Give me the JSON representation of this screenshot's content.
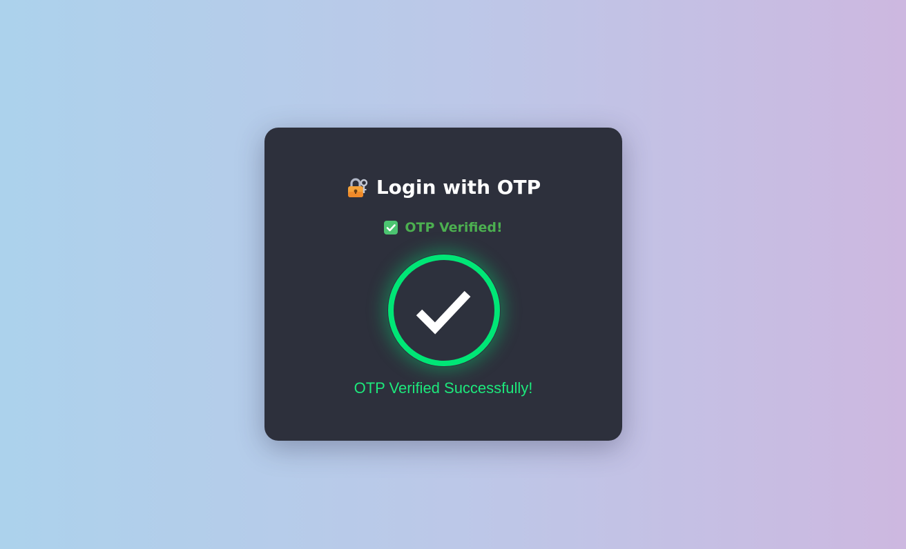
{
  "card": {
    "title": "Login with OTP",
    "title_icon": "lock-with-key-icon",
    "status_text": "OTP Verified!",
    "status_icon": "check-mark-button-icon",
    "success_icon": "large-check-circle-icon",
    "success_message": "OTP Verified Successfully!"
  },
  "colors": {
    "background_start": "#acd2ec",
    "background_end": "#cdb8e0",
    "card": "#2d303c",
    "title": "#ffffff",
    "status": "#4caf50",
    "success_ring": "#00e676",
    "success_text": "#1de97c"
  }
}
